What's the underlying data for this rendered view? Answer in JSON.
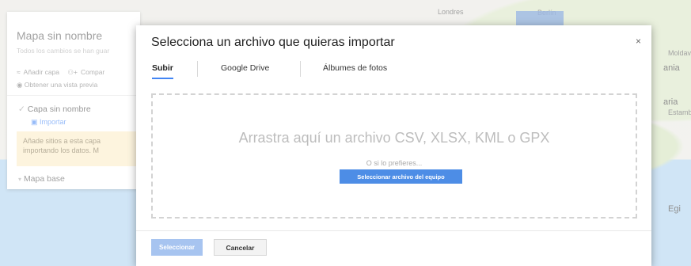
{
  "map": {
    "labels": [
      "Londres",
      "Berlín",
      "Moldavi",
      "ania",
      "aria",
      "Estamb",
      "Egi"
    ]
  },
  "panel": {
    "title": "Mapa sin nombre",
    "subtitle": "Todos los cambios se han guar",
    "add_layer": "Añadir capa",
    "share": "Compar",
    "preview": "Obtener una vista previa",
    "layer_name": "Capa sin nombre",
    "import_link": "Importar",
    "hint_line1": "Añade sitios a esta capa",
    "hint_line2": "importando los datos. M",
    "basemap": "Mapa base"
  },
  "dialog": {
    "title": "Selecciona un archivo que quieras importar",
    "close": "×",
    "tabs": [
      "Subir",
      "Google Drive",
      "Álbumes de fotos"
    ],
    "drop_text": "Arrastra aquí un archivo CSV, XLSX, KML o GPX",
    "or_text": "O si lo prefieres...",
    "file_button": "Seleccionar archivo del equipo",
    "select_button": "Seleccionar",
    "cancel_button": "Cancelar"
  }
}
